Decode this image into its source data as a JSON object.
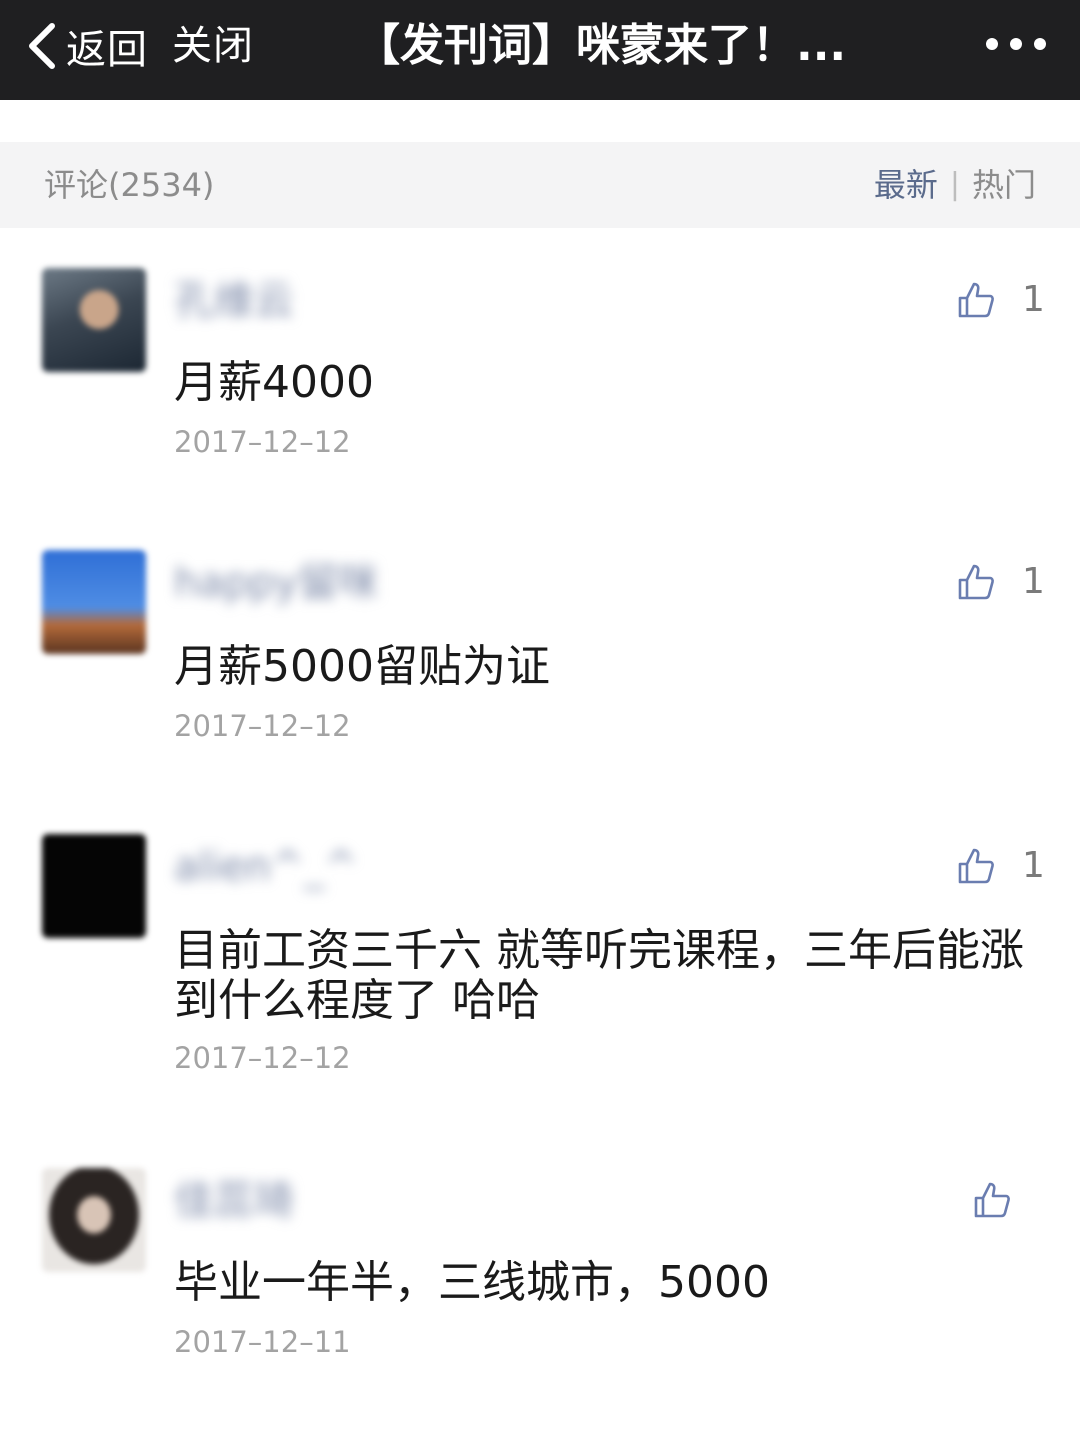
{
  "nav": {
    "back_label": "返回",
    "close_label": "关闭",
    "title": "【发刊词】咪蒙来了！..."
  },
  "comments_header": {
    "count_label": "评论(2534)",
    "sort_latest": "最新",
    "sort_divider": "|",
    "sort_hot": "热门"
  },
  "comments": [
    {
      "username": "孔维云",
      "content": "月薪4000",
      "date": "2017–12–12",
      "likes": "1"
    },
    {
      "username": "happy留咪",
      "content": "月薪5000留贴为证",
      "date": "2017–12–12",
      "likes": "1"
    },
    {
      "username": "alien^_^",
      "content": "目前工资三千六 就等听完课程，三年后能涨到什么程度了 哈哈",
      "date": "2017–12–12",
      "likes": "1"
    },
    {
      "username": "佳蕊琦",
      "content": "毕业一年半，三线城市，5000",
      "date": "2017–12–11",
      "likes": ""
    }
  ],
  "colors": {
    "navbar_bg": "#1f1f21",
    "accent_link": "#5b6b8c",
    "like_icon": "#6a7db0"
  },
  "icons": {
    "back": "chevron-left-icon",
    "more": "more-dots-icon",
    "like": "thumbs-up-icon"
  }
}
